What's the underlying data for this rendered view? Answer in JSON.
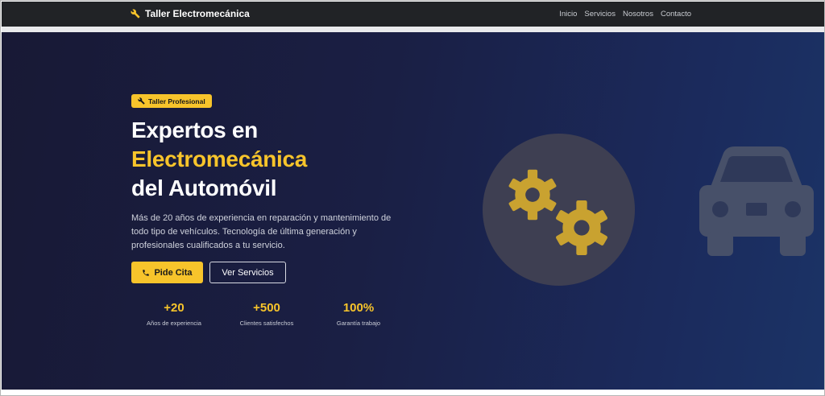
{
  "navbar": {
    "brand_icon": "wrench-icon",
    "brand": "Taller Electromecánica",
    "links": [
      "Inicio",
      "Servicios",
      "Nosotros",
      "Contacto"
    ]
  },
  "hero": {
    "badge_icon": "wrench-icon",
    "badge": "Taller Profesional",
    "headline_line1": "Expertos en",
    "headline_accent": "Electromecánica",
    "headline_line3": "del Automóvil",
    "description": "Más de 20 años de experiencia en reparación y mantenimiento de todo tipo de vehículos. Tecnología de última generación y profesionales cualificados a tu servicio.",
    "primary_button": "Pide Cita",
    "primary_button_icon": "phone-icon",
    "secondary_button": "Ver Servicios",
    "stats": [
      {
        "value": "+20",
        "label": "Años de experiencia"
      },
      {
        "value": "+500",
        "label": "Clientes satisfechos"
      },
      {
        "value": "100%",
        "label": "Garantía trabajo"
      }
    ],
    "illustration_icons": [
      "gears-icon",
      "car-icon"
    ]
  },
  "colors": {
    "accent": "#f7c42b",
    "navbar": "#212326",
    "hero_start": "#181935",
    "hero_end": "#1b3366",
    "gear": "#c9a230",
    "car": "#475069"
  }
}
